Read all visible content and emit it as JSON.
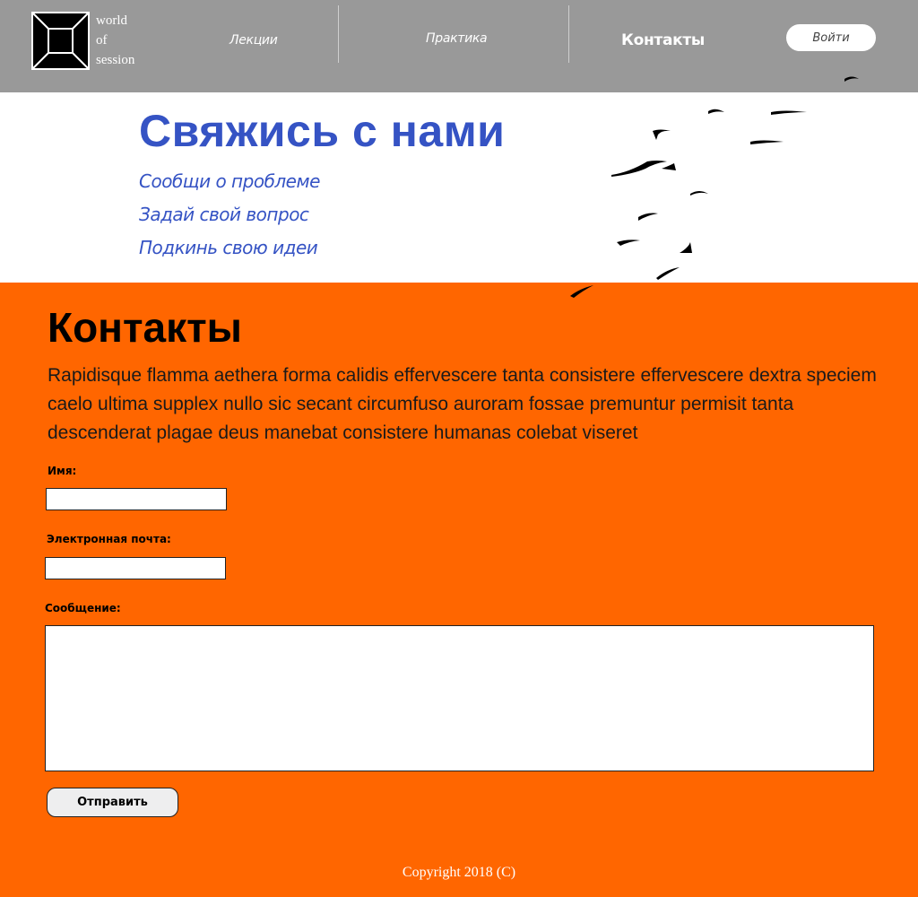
{
  "header": {
    "brand_lines": [
      "world",
      "of",
      "session"
    ],
    "nav": {
      "lectures": "Лекции",
      "practice": "Практика",
      "contacts": "Контакты"
    },
    "login_label": "Войти"
  },
  "hero": {
    "title": "Свяжись с нами",
    "lines": [
      "Сообщи о проблеме",
      "Задай свой вопрос",
      "Подкинь свою идеи"
    ]
  },
  "contacts": {
    "title": "Контакты",
    "text": "Rapidisque flamma aethera forma calidis effervescere tanta consistere effervescere dextra speciem caelo ultima supplex nullo sic secant circumfuso auroram fossae premuntur permisit tanta descenderat plagae deus manebat consistere humanas colebat viseret"
  },
  "form": {
    "name_label": "Имя:",
    "email_label": "Электронная почта:",
    "message_label": "Сообщение:",
    "name_value": "",
    "email_value": "",
    "message_value": "",
    "submit_label": "Отправить"
  },
  "footer": {
    "copyright": "Copyright 2018 (C)"
  },
  "colors": {
    "header_bg": "#999999",
    "accent_blue": "#3553c4",
    "main_bg": "#ff6600"
  },
  "icons": {
    "logo": "square-frame-logo-icon",
    "birds": "flying-birds-decoration"
  }
}
